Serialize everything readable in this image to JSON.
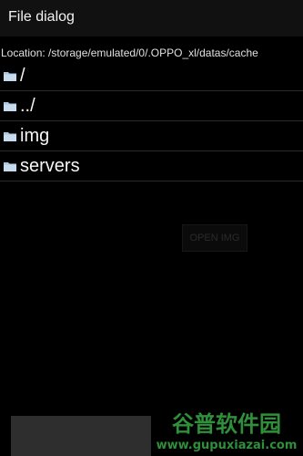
{
  "dialog": {
    "title": "File dialog"
  },
  "location": {
    "text": "Location: /storage/emulated/0/.OPPO_xl/datas/cache"
  },
  "files": [
    {
      "name": "/",
      "icon": "folder-icon"
    },
    {
      "name": "../",
      "icon": "folder-icon"
    },
    {
      "name": "img",
      "icon": "folder-icon"
    },
    {
      "name": "servers",
      "icon": "folder-icon"
    }
  ],
  "actions": {
    "open_label": "OPEN IMG"
  },
  "watermark": {
    "line1": "谷普软件园",
    "line2": "www.gupuxiazai.com"
  },
  "colors": {
    "background": "#000000",
    "folder": "#a9c4de",
    "watermark": "#2f8f3a"
  }
}
